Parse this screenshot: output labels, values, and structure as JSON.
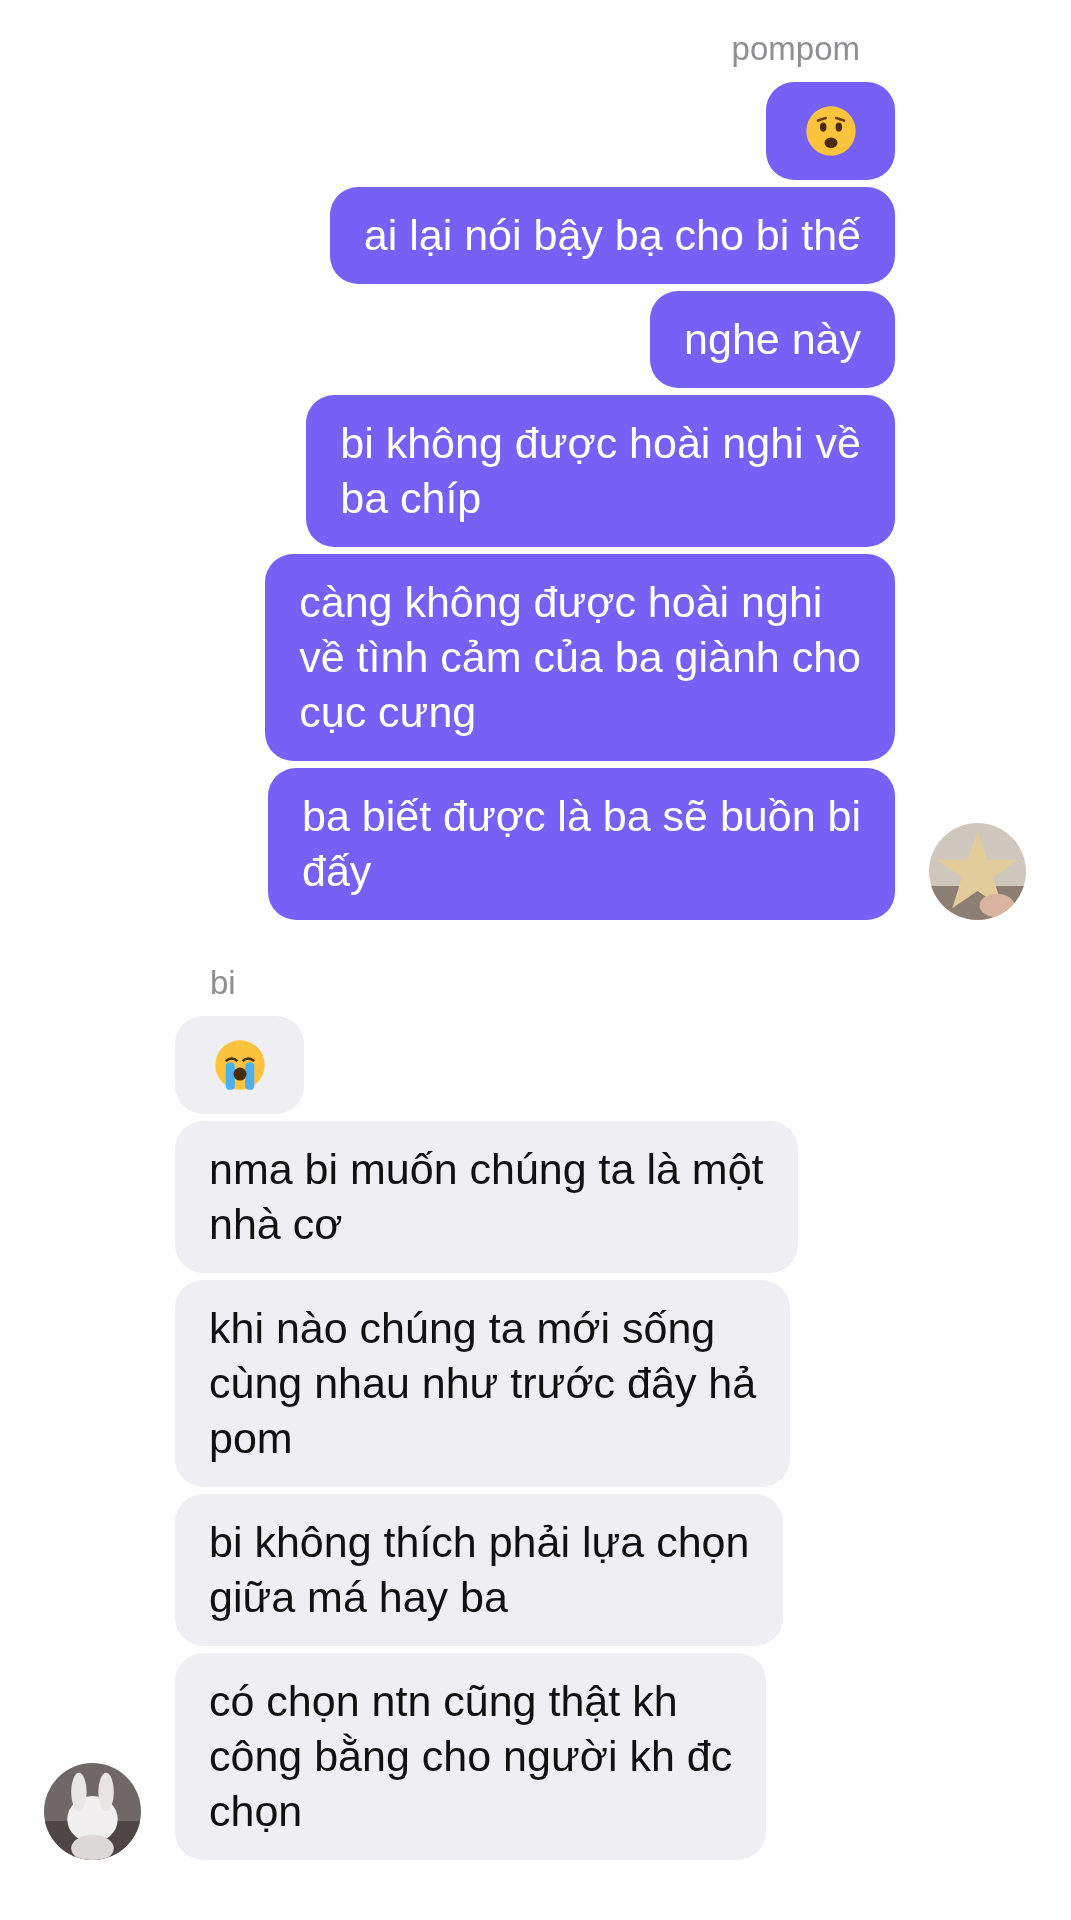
{
  "groups": [
    {
      "from_me": true,
      "sender": "pompom",
      "messages": [
        {
          "kind": "worried"
        },
        {
          "kind": "text",
          "lines": [
            "ai lại nói bậy bạ cho bi thế"
          ]
        },
        {
          "kind": "text",
          "lines": [
            "nghe này"
          ]
        },
        {
          "kind": "text",
          "lines": [
            "bi không được hoài nghi về",
            "ba chíp"
          ]
        },
        {
          "kind": "text",
          "lines": [
            "càng không được hoài nghi",
            "về tình cảm của ba giành cho",
            "cục cưng"
          ]
        },
        {
          "kind": "text",
          "lines": [
            "ba biết được là ba sẽ buồn bi",
            "đấy"
          ]
        }
      ]
    },
    {
      "from_me": false,
      "sender": "bi",
      "messages": [
        {
          "kind": "crying"
        },
        {
          "kind": "text",
          "lines": [
            "nma bi muốn chúng ta là một",
            "nhà cơ"
          ]
        },
        {
          "kind": "text",
          "lines": [
            "khi nào chúng ta mới sống",
            "cùng nhau như trước đây hả",
            "pom"
          ]
        },
        {
          "kind": "text",
          "lines": [
            "bi không thích phải lựa chọn",
            "giữa má hay ba"
          ]
        },
        {
          "kind": "text",
          "lines": [
            "có chọn ntn cũng thật kh",
            "công bằng cho người kh đc",
            "chọn"
          ]
        }
      ]
    }
  ]
}
